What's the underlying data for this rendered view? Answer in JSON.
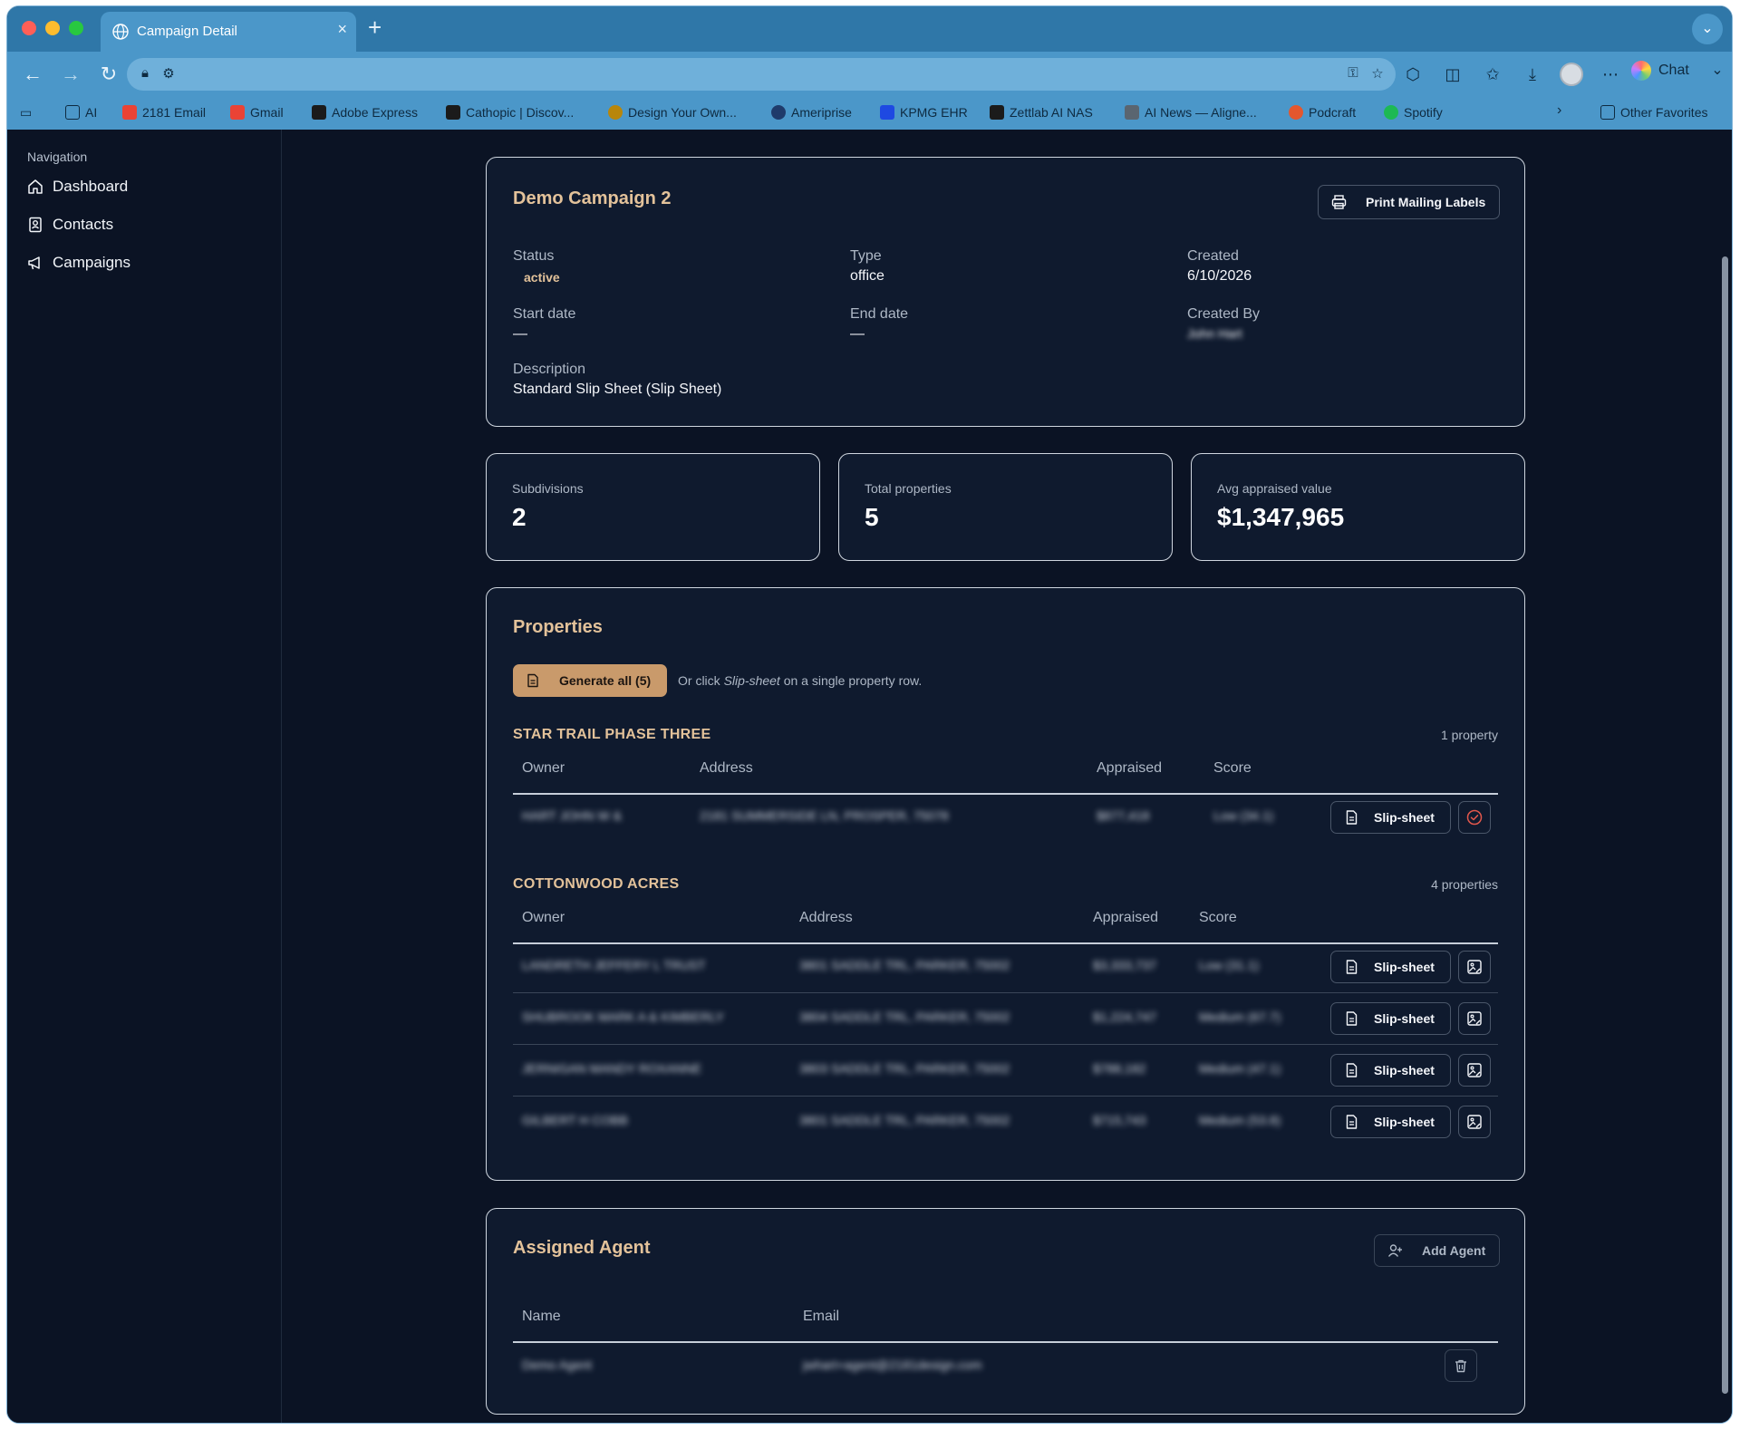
{
  "browser": {
    "tab_title": "Campaign Detail",
    "tab_close": "×",
    "new_tab": "+",
    "chat_label": "Chat"
  },
  "favorites": [
    {
      "label": "AI",
      "color": "#0e2a40"
    },
    {
      "label": "2181 Email",
      "color": "#ea4335"
    },
    {
      "label": "Gmail",
      "color": "#ea4335"
    },
    {
      "label": "Adobe Express",
      "color": "#1b1b1b"
    },
    {
      "label": "Cathopic | Discov...",
      "color": "#1b1b1b"
    },
    {
      "label": "Design Your Own...",
      "color": "#b8860b"
    },
    {
      "label": "Ameriprise",
      "color": "#1f3b6b"
    },
    {
      "label": "KPMG EHR",
      "color": "#1e49e2"
    },
    {
      "label": "Zettlab AI NAS",
      "color": "#1b1b1b"
    },
    {
      "label": "AI News — Aligne...",
      "color": "#5a6570"
    },
    {
      "label": "Podcraft",
      "color": "#e4572e"
    },
    {
      "label": "Spotify",
      "color": "#1db954"
    },
    {
      "label": "Other Favorites",
      "color": "#0e2a40"
    }
  ],
  "sidebar": {
    "heading": "Navigation",
    "items": [
      {
        "label": "Dashboard",
        "icon": "home-icon"
      },
      {
        "label": "Contacts",
        "icon": "contacts-icon"
      },
      {
        "label": "Campaigns",
        "icon": "megaphone-icon"
      }
    ]
  },
  "campaign": {
    "title": "Demo Campaign 2",
    "print_button": "Print Mailing Labels",
    "fields": {
      "status_label": "Status",
      "status_value": "active",
      "type_label": "Type",
      "type_value": "office",
      "created_label": "Created",
      "created_value": "6/10/2026",
      "start_label": "Start date",
      "start_value": "—",
      "end_label": "End date",
      "end_value": "—",
      "created_by_label": "Created By",
      "created_by_value": "John Hart",
      "description_label": "Description",
      "description_value": "Standard Slip Sheet (Slip Sheet)"
    }
  },
  "stats": [
    {
      "label": "Subdivisions",
      "value": "2"
    },
    {
      "label": "Total properties",
      "value": "5"
    },
    {
      "label": "Avg appraised value",
      "value": "$1,347,965"
    }
  ],
  "properties": {
    "title": "Properties",
    "generate_button": "Generate all (5)",
    "hint_prefix": "Or click ",
    "hint_em": "Slip-sheet",
    "hint_suffix": " on a single property row.",
    "columns": {
      "owner": "Owner",
      "address": "Address",
      "appraised": "Appraised",
      "score": "Score"
    },
    "slip_label": "Slip-sheet",
    "groups": [
      {
        "name": "STAR TRAIL PHASE THREE",
        "count": "1 property",
        "rows": [
          {
            "owner": "HART JOHN W &",
            "address": "2181 SUMMERSIDE LN, PROSPER, 75078",
            "appraised": "$877,418",
            "score": "Low (34.1)",
            "action_icon": "check-circle-icon"
          }
        ]
      },
      {
        "name": "COTTONWOOD ACRES",
        "count": "4 properties",
        "rows": [
          {
            "owner": "LANDRETH JEFFERY L TRUST",
            "address": "3801 SADDLE TRL, PARKER, 75002",
            "appraised": "$3,333,737",
            "score": "Low (31.1)",
            "action_icon": "image-edit-icon"
          },
          {
            "owner": "SHUBROOK MARK A & KIMBERLY",
            "address": "3804 SADDLE TRL, PARKER, 75002",
            "appraised": "$1,224,747",
            "score": "Medium (67.7)",
            "action_icon": "image-edit-icon"
          },
          {
            "owner": "JERNIGAN MANDY ROXANNE",
            "address": "3803 SADDLE TRL, PARKER, 75002",
            "appraised": "$788,182",
            "score": "Medium (47.1)",
            "action_icon": "image-edit-icon"
          },
          {
            "owner": "GILBERT H COBB",
            "address": "3801 SADDLE TRL, PARKER, 75002",
            "appraised": "$715,743",
            "score": "Medium (53.8)",
            "action_icon": "image-edit-icon"
          }
        ]
      }
    ]
  },
  "agent": {
    "title": "Assigned Agent",
    "add_button": "Add Agent",
    "columns": {
      "name": "Name",
      "email": "Email"
    },
    "rows": [
      {
        "name": "Demo Agent",
        "email": "jwhart+agent@2181design.com"
      }
    ]
  },
  "colors": {
    "accent": "#c99a6b",
    "heading_accent": "#e3c29a",
    "page_bg": "#0b1324",
    "card_bg": "#0f1a2e",
    "browser_chrome": "#4b97c9"
  }
}
